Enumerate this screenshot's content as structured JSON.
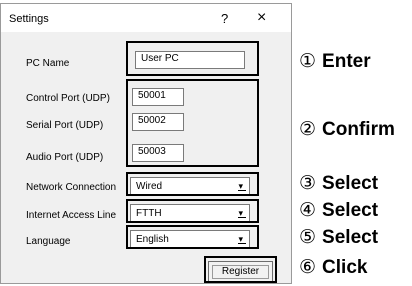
{
  "window": {
    "title": "Settings",
    "help": "?",
    "close": "×"
  },
  "fields": {
    "pc_name": {
      "label": "PC Name",
      "value": "User PC"
    },
    "control_port": {
      "label": "Control Port (UDP)",
      "value": "50001"
    },
    "serial_port": {
      "label": "Serial Port (UDP)",
      "value": "50002"
    },
    "audio_port": {
      "label": "Audio Port (UDP)",
      "value": "50003"
    },
    "network_connection": {
      "label": "Network Connection",
      "value": "Wired"
    },
    "internet_access_line": {
      "label": "Internet Access Line",
      "value": "FTTH"
    },
    "language": {
      "label": "Language",
      "value": "English"
    }
  },
  "register_label": "Register",
  "annotations": [
    {
      "num": "①",
      "text": "Enter"
    },
    {
      "num": "②",
      "text": "Confirm"
    },
    {
      "num": "③",
      "text": "Select"
    },
    {
      "num": "④",
      "text": "Select"
    },
    {
      "num": "⑤",
      "text": "Select"
    },
    {
      "num": "⑥",
      "text": "Click"
    }
  ]
}
